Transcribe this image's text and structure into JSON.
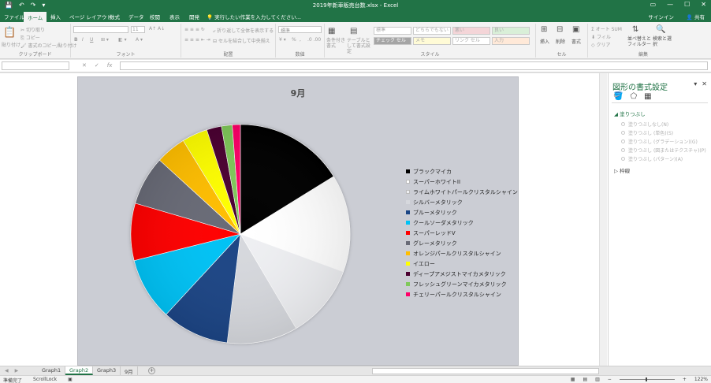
{
  "window": {
    "title": "2019年新車販売台数.xlsx - Excel",
    "qat": [
      "💾",
      "↶",
      "↷",
      "▾"
    ],
    "controls": [
      "▭",
      "—",
      "☐",
      "✕"
    ]
  },
  "ribbon_tabs": {
    "file": "ファイル",
    "home": "ホーム",
    "insert": "挿入",
    "page_layout": "ページ レイアウト",
    "formulas": "数式",
    "data": "データ",
    "review": "校閲",
    "view": "表示",
    "develop": "開発",
    "tell_me": "実行したい作業を入力してください...",
    "signin": "サインイン",
    "share": "共有"
  },
  "ribbon": {
    "clipboard": {
      "label": "クリップボード",
      "paste": "貼り付け",
      "cut": "切り取り",
      "copy": "コピー",
      "format_painter": "書式のコピー/貼り付け"
    },
    "font": {
      "label": "フォント",
      "size": "11",
      "bold": "B",
      "italic": "I",
      "underline": "U"
    },
    "alignment": {
      "label": "配置",
      "wrap": "折り返して全体を表示する",
      "merge": "セルを結合して中央揃え"
    },
    "number": {
      "label": "数値",
      "format": "標準",
      "percent": "%",
      "comma": ","
    },
    "styles": {
      "label": "スタイル",
      "conditional": "条件付き書式",
      "table": "テーブルとして書式設定",
      "cells": [
        "標準",
        "どちらでもない",
        "悪い",
        "良い",
        "チェック セル",
        "メモ",
        "リンク セル",
        "入力"
      ]
    },
    "cells": {
      "label": "セル",
      "insert": "挿入",
      "delete": "削除",
      "format": "書式"
    },
    "editing": {
      "label": "編集",
      "autosum": "オート SUM",
      "fill": "フィル",
      "clear": "クリア",
      "sort": "並べ替えとフィルター",
      "find": "検索と選択"
    }
  },
  "formula_bar": {
    "name_box": "",
    "fx": "fx",
    "cancel": "✕",
    "enter": "✓",
    "value": ""
  },
  "chart_data": {
    "type": "pie",
    "title": "9月",
    "categories": [
      "ブラックマイカ",
      "スーパーホワイトII",
      "ライムホワイトパールクリスタルシャイン",
      "シルバーメタリック",
      "ブルーメタリック",
      "クールソーダメタリック",
      "スーパーレッドV",
      "グレーメタリック",
      "オレンジパールクリスタルシャイン",
      "イエロー",
      "ディープアメジストマイカメタリック",
      "フレッシュグリーンマイカメタリック",
      "チェリーパールクリスタルシャイン"
    ],
    "values": [
      16.3,
      14.5,
      11.0,
      10.5,
      10.0,
      9.3,
      8.5,
      7.3,
      4.5,
      3.8,
      2.2,
      1.6,
      1.2
    ],
    "colors": [
      "#000000",
      "#ffffff",
      "#eeeff2",
      "#d6d8dd",
      "#1a4585",
      "#00c2f5",
      "#ff0000",
      "#686a76",
      "#ffbe00",
      "#ffff00",
      "#4b0030",
      "#80c85a",
      "#ff0068"
    ],
    "legend_position": "right"
  },
  "task_pane": {
    "title": "図形の書式設定",
    "close": "✕",
    "collapse": "▾",
    "icons": [
      "🪣",
      "⬠",
      "▦"
    ],
    "fill_section": "塗りつぶし",
    "fill_options": [
      "塗りつぶしなし(N)",
      "塗りつぶし (単色)(S)",
      "塗りつぶし (グラデーション)(G)",
      "塗りつぶし (図またはテクスチャ)(P)",
      "塗りつぶし (パターン)(A)"
    ],
    "border_section": "▷ 枠線"
  },
  "sheet_tabs": [
    "Graph1",
    "Graph2",
    "Graph3",
    "9月"
  ],
  "active_sheet": "Graph2",
  "status": {
    "ready": "準備完了",
    "scroll_lock": "ScrollLock",
    "zoom": "122%"
  }
}
